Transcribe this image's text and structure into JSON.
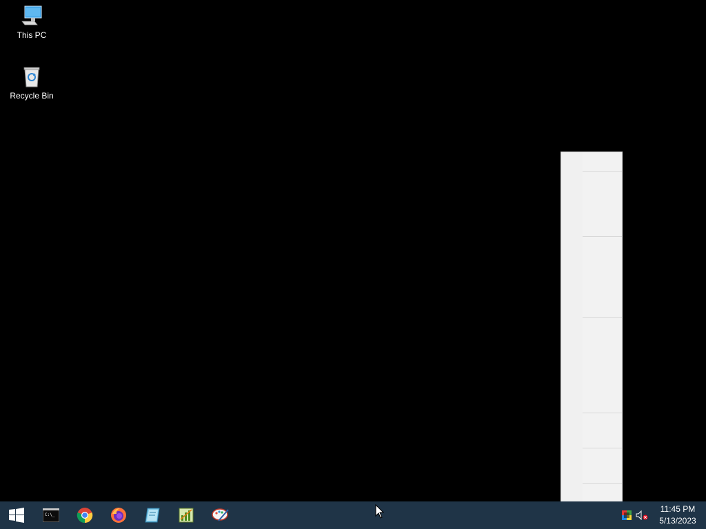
{
  "desktop": {
    "icons": [
      {
        "label": "This PC",
        "icon": "computer-icon"
      },
      {
        "label": "Recycle Bin",
        "icon": "recycle-bin-icon"
      }
    ]
  },
  "taskbar": {
    "buttons": [
      {
        "icon": "windows-start-icon"
      },
      {
        "icon": "command-prompt-icon"
      },
      {
        "icon": "chrome-icon"
      },
      {
        "icon": "firefox-icon"
      },
      {
        "icon": "notebook-app-icon"
      },
      {
        "icon": "chart-app-icon"
      },
      {
        "icon": "paint-app-icon"
      }
    ],
    "tray": {
      "icons": [
        "color-app-icon",
        "volume-muted-icon"
      ],
      "time": "11:45 PM",
      "date": "5/13/2023"
    }
  },
  "colors": {
    "taskbar": "#1f3447",
    "desktop": "#000000",
    "panel": "#f2f2f2"
  }
}
